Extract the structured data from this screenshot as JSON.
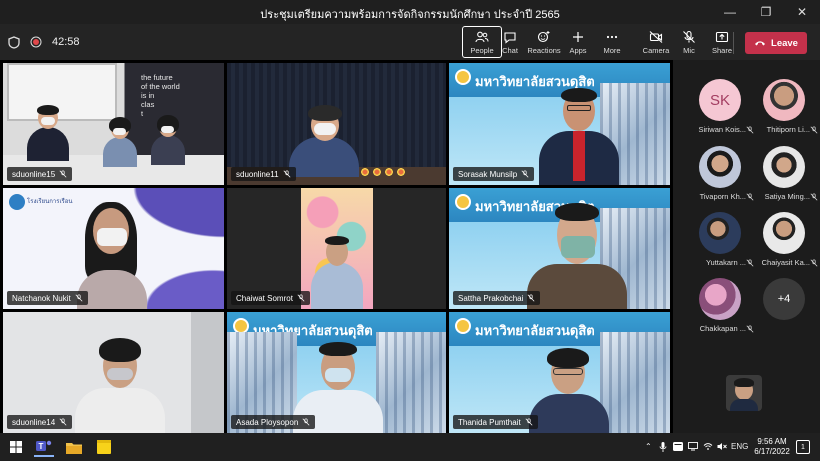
{
  "window": {
    "title": "ประชุมเตรียมความพร้อมการจัดกิจกรรมนักศึกษา ประจำปี 2565"
  },
  "meeting": {
    "timer": "42:58",
    "buttons": {
      "people": "People",
      "chat": "Chat",
      "reactions": "Reactions",
      "apps": "Apps",
      "more": "More",
      "camera": "Camera",
      "mic": "Mic",
      "share": "Share",
      "leave": "Leave"
    }
  },
  "video_tiles": [
    {
      "name": "sduonline15"
    },
    {
      "name": "sduonline11"
    },
    {
      "name": "Sorasak Munsilp"
    },
    {
      "name": "Natchanok Nukit"
    },
    {
      "name": "Chaiwat Somrot"
    },
    {
      "name": "Sattha Prakobchai"
    },
    {
      "name": "sduonline14"
    },
    {
      "name": "Asada Ploysopon"
    },
    {
      "name": "Thanida Pumthait"
    }
  ],
  "backgrounds": {
    "wall_text": [
      "the future",
      "of the world",
      "is in",
      "clas",
      "t"
    ],
    "university_banner": "มหาวิทยาลัยสวนดุสิต",
    "school_banner": "โรงเรียนการเรือน"
  },
  "attendees": [
    {
      "name": "Siriwan Kois...",
      "initials": "SK"
    },
    {
      "name": "Thitiporn Li..."
    },
    {
      "name": "Tivaporn Kh..."
    },
    {
      "name": "Satiya Ming..."
    },
    {
      "name": "Yuttakarn ..."
    },
    {
      "name": "Chaiyasit Ka..."
    },
    {
      "name": "Chakkapan ..."
    }
  ],
  "overflow_count": "+4",
  "taskbar": {
    "language": "ENG",
    "time": "9:56 AM",
    "date": "6/17/2022",
    "notification_count": "1"
  },
  "colors": {
    "leave_button": "#c4314b",
    "title_bar": "#1f1f1f",
    "controls_bar": "#242424",
    "taskbar": "#202020"
  }
}
